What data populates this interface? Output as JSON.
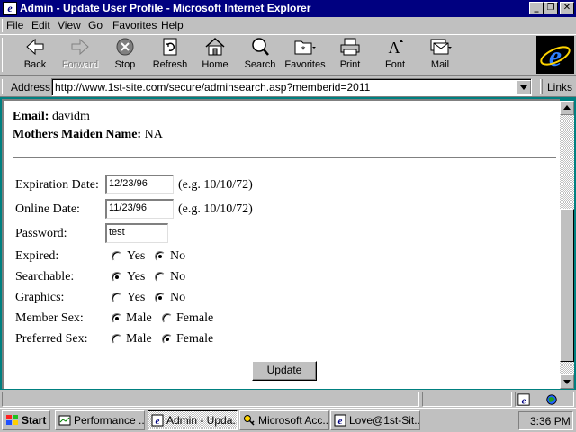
{
  "window": {
    "title": "Admin - Update User Profile - Microsoft Internet Explorer"
  },
  "menu": [
    "File",
    "Edit",
    "View",
    "Go",
    "Favorites",
    "Help"
  ],
  "toolbar": {
    "back": "Back",
    "forward": "Forward",
    "stop": "Stop",
    "refresh": "Refresh",
    "home": "Home",
    "search": "Search",
    "favorites": "Favorites",
    "print": "Print",
    "font": "Font",
    "mail": "Mail"
  },
  "address": {
    "label": "Address",
    "url": "http://www.1st-site.com/secure/adminsearch.asp?memberid=2011",
    "links_label": "Links"
  },
  "profile": {
    "email_label": "Email:",
    "email_value": "davidm",
    "maiden_label": "Mothers Maiden Name:",
    "maiden_value": "NA"
  },
  "form": {
    "expiration_label": "Expiration Date:",
    "expiration_value": "12/23/96",
    "expiration_hint": "(e.g. 10/10/72)",
    "online_label": "Online Date:",
    "online_value": "11/23/96",
    "online_hint": "(e.g. 10/10/72)",
    "password_label": "Password:",
    "password_value": "test",
    "expired_label": "Expired:",
    "searchable_label": "Searchable:",
    "graphics_label": "Graphics:",
    "sex_label": "Member Sex:",
    "pref_label": "Preferred Sex:",
    "yes": "Yes",
    "no": "No",
    "male": "Male",
    "female": "Female",
    "expired_selected": "No",
    "searchable_selected": "Yes",
    "graphics_selected": "No",
    "sex_selected": "Male",
    "pref_selected": "Female",
    "update_button": "Update"
  },
  "taskbar": {
    "start": "Start",
    "tasks": [
      "Performance ...",
      "Admin - Upda...",
      "Microsoft Acc...",
      "Love@1st-Sit..."
    ],
    "active_task": "Admin - Upda...",
    "clock": "3:36 PM"
  },
  "colors": {
    "titlebar": "#000080",
    "face": "#c0c0c0",
    "desktop": "#008080"
  }
}
